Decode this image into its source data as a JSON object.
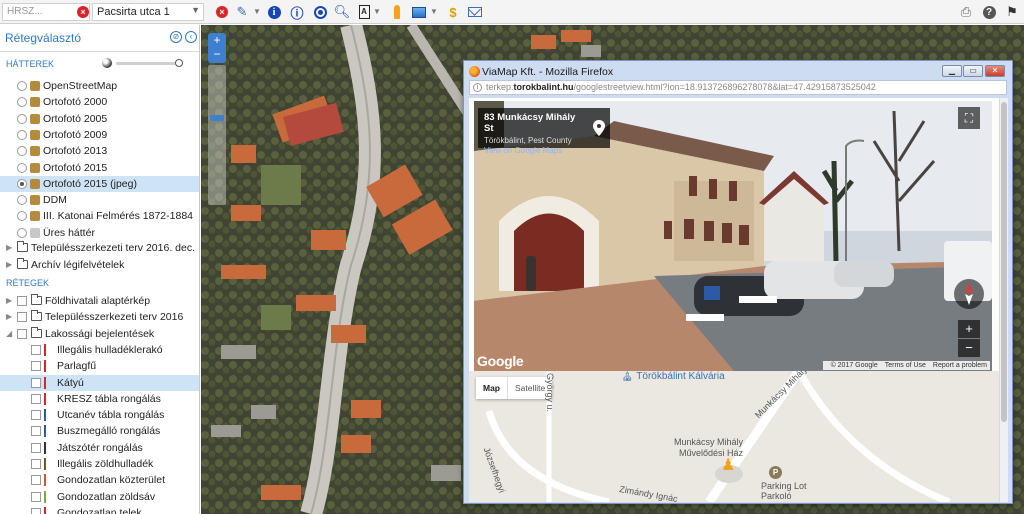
{
  "toolbar": {
    "hrsz_placeholder": "HRSZ...",
    "address_value": "Pacsirta utca 1",
    "icons": [
      "clear-icon",
      "ruler-icon",
      "info-icon",
      "identify-icon",
      "target-icon",
      "zoom-search-icon",
      "print-layout-icon",
      "pegman-icon",
      "image-icon",
      "dollar-icon",
      "mail-icon",
      "printer-icon",
      "help-icon",
      "flag-icon"
    ]
  },
  "panel": {
    "title": "Rétegválasztó",
    "sections": {
      "backgrounds": "HÁTTEREK",
      "layers": "RÉTEGEK"
    },
    "backgrounds": [
      {
        "label": "OpenStreetMap"
      },
      {
        "label": "Ortofotó 2000"
      },
      {
        "label": "Ortofotó 2005"
      },
      {
        "label": "Ortofotó 2009"
      },
      {
        "label": "Ortofotó 2013"
      },
      {
        "label": "Ortofotó 2015"
      },
      {
        "label": "Ortofotó 2015 (jpeg)",
        "selected": true
      },
      {
        "label": "DDM"
      },
      {
        "label": "III. Katonai Felmérés 1872-1884"
      },
      {
        "label": "Üres háttér"
      }
    ],
    "folders": [
      {
        "label": "Településszerkezeti terv 2016. dec."
      },
      {
        "label": "Archív légifelvételek"
      }
    ],
    "layers": [
      {
        "label": "Földhivatali alaptérkép"
      },
      {
        "label": "Településszerkezeti terv 2016"
      },
      {
        "label": "Lakossági bejelentések"
      },
      {
        "label": "Illegális hulladéklerakó"
      },
      {
        "label": "Parlagfű"
      },
      {
        "label": "Kátyú",
        "selected": true
      },
      {
        "label": "KRESZ tábla rongálás"
      },
      {
        "label": "Utcanév tábla rongálás"
      },
      {
        "label": "Buszmegálló rongálás"
      },
      {
        "label": "Játszótér rongálás"
      },
      {
        "label": "Illegális zöldhulladék"
      },
      {
        "label": "Gondozatlan közterület"
      },
      {
        "label": "Gondozatlan zöldsáv"
      },
      {
        "label": "Gondozatlan telek"
      }
    ]
  },
  "map": {
    "zoom_in": "+",
    "zoom_out": "−"
  },
  "popup": {
    "title": "ViaMap Kft. - Mozilla Firefox",
    "url_prefix": "terkep.",
    "url_domain": "torokbalint.hu",
    "url_suffix": "/googlestreetview.html?lon=18.913726896278078&lat=47.42915873525042",
    "streetview": {
      "address": "83 Munkácsy Mihály St",
      "place": "Törökbálint, Pest County",
      "link": "View on Google Maps",
      "brand": "Google",
      "copyright": "© 2017 Google",
      "terms": "Terms of Use",
      "report": "Report a problem"
    },
    "minimap": {
      "map_btn": "Map",
      "satellite_btn": "Satellite",
      "poi_kalvaria": "Törökbálint Kálvária",
      "street_munkacsy": "Munkácsy Mihály u.",
      "poi_muvelodesi_1": "Munkácsy Mihály",
      "poi_muvelodesi_2": "Művelődési Ház",
      "parking_1": "Parking Lot",
      "parking_2": "Parkoló",
      "street_zimandy": "Zimándy Ignác",
      "street_jozsefhegyi": "Józsefhegyi",
      "street_gyorgy": "György u."
    }
  }
}
